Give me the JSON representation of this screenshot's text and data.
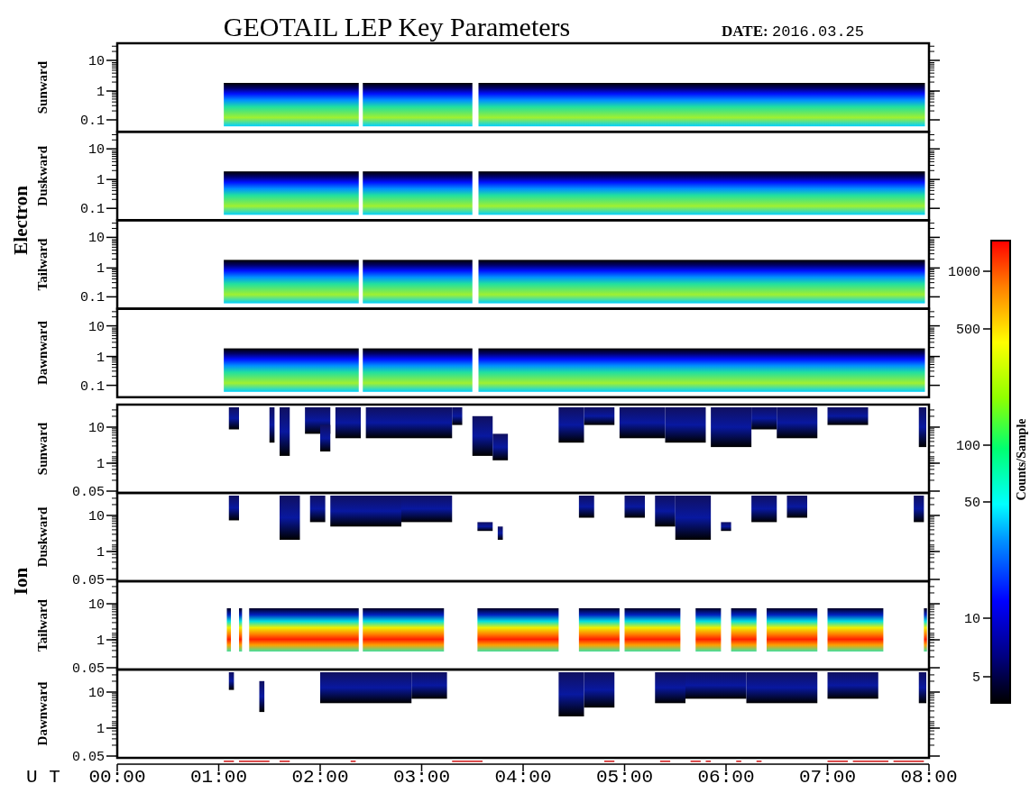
{
  "title": "GEOTAIL LEP Key Parameters",
  "date_label": "DATE:",
  "date": "2016.03.25",
  "groups": [
    {
      "label": "Electron",
      "kind": "electron",
      "panels": [
        {
          "label": "Sunward",
          "yticks": [
            "10",
            "1",
            "0.1"
          ]
        },
        {
          "label": "Duskward",
          "yticks": [
            "10",
            "1",
            "0.1"
          ]
        },
        {
          "label": "Tailward",
          "yticks": [
            "10",
            "1",
            "0.1"
          ]
        },
        {
          "label": "Dawnward",
          "yticks": [
            "10",
            "1",
            "0.1"
          ]
        }
      ]
    },
    {
      "label": "Ion",
      "kind": "ion",
      "panels": [
        {
          "label": "Sunward",
          "yticks": [
            "10",
            "1",
            "0.05"
          ]
        },
        {
          "label": "Duskward",
          "yticks": [
            "10",
            "1",
            "0.05"
          ]
        },
        {
          "label": "Tailward",
          "yticks": [
            "10",
            "1",
            "0.05"
          ]
        },
        {
          "label": "Dawnward",
          "yticks": [
            "10",
            "1",
            "0.05"
          ]
        }
      ]
    }
  ],
  "xaxis": {
    "label": "U T",
    "ticks": [
      "00:00",
      "01:00",
      "02:00",
      "03:00",
      "04:00",
      "05:00",
      "06:00",
      "07:00",
      "08:00"
    ]
  },
  "colorbar": {
    "label": "Counts/Sample",
    "ticks": [
      "1000",
      "500",
      "100",
      "50",
      "10",
      "5"
    ]
  }
}
